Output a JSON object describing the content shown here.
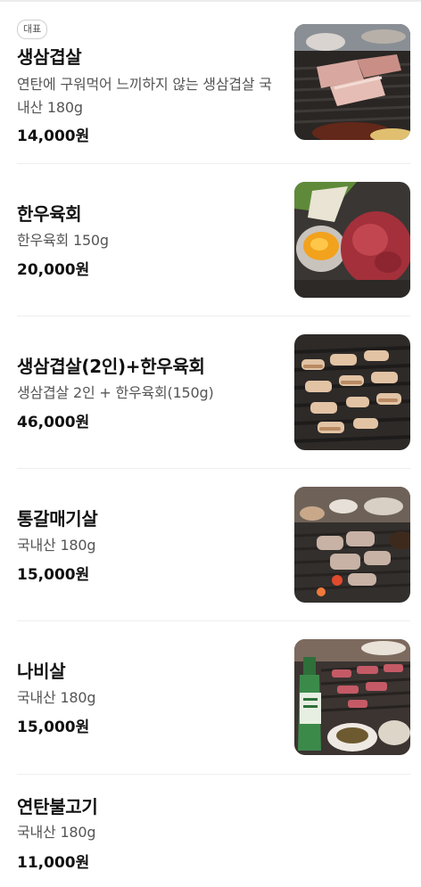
{
  "menu": [
    {
      "badge": "대표",
      "name": "생삼겹살",
      "desc": "연탄에 구워먹어 느끼하지 않는 생삼겹살 국내산 180g",
      "price": "14,000원",
      "photo": "pork-belly-grill-photo"
    },
    {
      "name": "한우육회",
      "desc": "한우육회 150g",
      "price": "20,000원",
      "photo": "beef-tartare-photo"
    },
    {
      "name": "생삼겹살(2인)+한우육회",
      "desc": "생삼겹살 2인 + 한우육회(150g)",
      "price": "46,000원",
      "photo": "grilled-pork-set-photo"
    },
    {
      "name": "통갈매기살",
      "desc": "국내산 180g",
      "price": "15,000원",
      "photo": "skirt-meat-grill-photo"
    },
    {
      "name": "나비살",
      "desc": "국내산 180g",
      "price": "15,000원",
      "photo": "nabi-meat-soju-photo"
    },
    {
      "name": "연탄불고기",
      "desc": "국내산 180g",
      "price": "11,000원"
    }
  ]
}
